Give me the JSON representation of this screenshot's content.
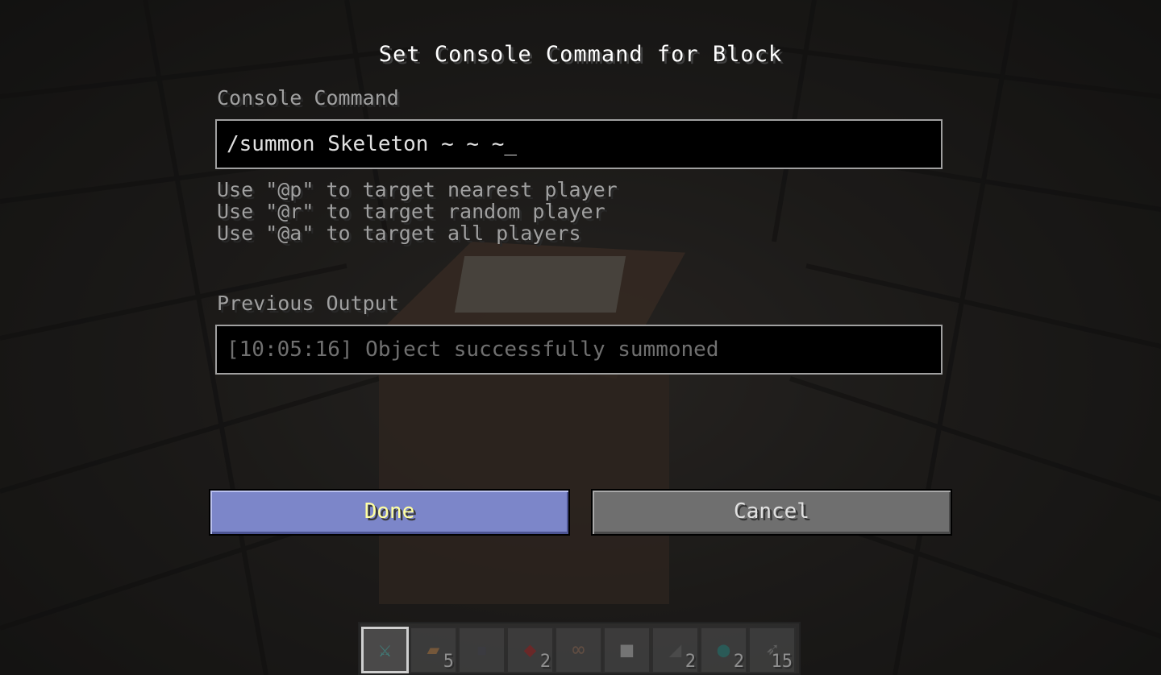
{
  "dialog": {
    "title": "Set Console Command for Block",
    "command_label": "Console Command",
    "command_value": "/summon Skeleton ~ ~ ~",
    "caret": "_",
    "hints": [
      "Use \"@p\" to target nearest player",
      "Use \"@r\" to target random player",
      "Use \"@a\" to target all players"
    ],
    "output_label": "Previous Output",
    "output_value": "[10:05:16] Object successfully summoned",
    "done_label": "Done",
    "cancel_label": "Cancel"
  },
  "hotbar": {
    "selected_slot": 0,
    "slots": [
      {
        "icon": "diamond-sword-icon",
        "glyph": "⚔",
        "color": "#39a7a0",
        "count": ""
      },
      {
        "icon": "bread-icon",
        "glyph": "▰",
        "color": "#9a6a3a",
        "count": "5"
      },
      {
        "icon": "flint-icon",
        "glyph": "▪",
        "color": "#3c3c44",
        "count": ""
      },
      {
        "icon": "redstone-icon",
        "glyph": "◆",
        "color": "#8a1d1d",
        "count": "2"
      },
      {
        "icon": "lead-icon",
        "glyph": "∞",
        "color": "#7a5a48",
        "count": ""
      },
      {
        "icon": "stone-block-icon",
        "glyph": "■",
        "color": "#9a9a9a",
        "count": ""
      },
      {
        "icon": "flint-and-steel-icon",
        "glyph": "◢",
        "color": "#555555",
        "count": "2"
      },
      {
        "icon": "ender-pearl-icon",
        "glyph": "●",
        "color": "#1f6f6a",
        "count": "2"
      },
      {
        "icon": "arrow-icon",
        "glyph": "➶",
        "color": "#777777",
        "count": "15"
      }
    ]
  }
}
